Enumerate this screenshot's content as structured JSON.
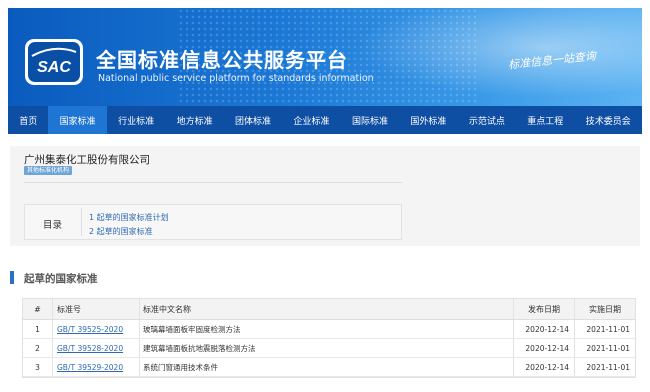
{
  "header": {
    "logo_text": "SAC",
    "title_cn": "全国标准信息公共服务平台",
    "title_en": "National public service platform  for standards information",
    "slogan": "标准信息一站查询"
  },
  "nav": {
    "items": [
      {
        "label": "首页"
      },
      {
        "label": "国家标准"
      },
      {
        "label": "行业标准"
      },
      {
        "label": "地方标准"
      },
      {
        "label": "团体标准"
      },
      {
        "label": "企业标准"
      },
      {
        "label": "国际标准"
      },
      {
        "label": "国外标准"
      },
      {
        "label": "示范试点"
      },
      {
        "label": "重点工程"
      },
      {
        "label": "技术委员会"
      }
    ],
    "active_index": 1
  },
  "org": {
    "name": "广州集泰化工股份有限公司",
    "tag": "其他标准化机构"
  },
  "toc": {
    "label": "目录",
    "links": [
      {
        "text": "1  起草的国家标准计划"
      },
      {
        "text": "2  起草的国家标准"
      }
    ]
  },
  "section": {
    "title": "起草的国家标准"
  },
  "table": {
    "headers": {
      "index": "#",
      "code": "标准号",
      "name": "标准中文名称",
      "publish": "发布日期",
      "implement": "实施日期"
    },
    "rows": [
      {
        "index": "1",
        "code": "GB/T 39525-2020",
        "name": "玻璃幕墙面板牢固度检测方法",
        "publish": "2020-12-14",
        "implement": "2021-11-01"
      },
      {
        "index": "2",
        "code": "GB/T 39528-2020",
        "name": "建筑幕墙面板抗地震脱落检测方法",
        "publish": "2020-12-14",
        "implement": "2021-11-01"
      },
      {
        "index": "3",
        "code": "GB/T 39529-2020",
        "name": "系统门窗通用技术条件",
        "publish": "2020-12-14",
        "implement": "2021-11-01"
      }
    ]
  },
  "colors": {
    "nav_bg": "#0e4ea3",
    "nav_active": "#1f75d4",
    "link": "#2f68b3",
    "tag_bg": "#6fa5d5"
  }
}
